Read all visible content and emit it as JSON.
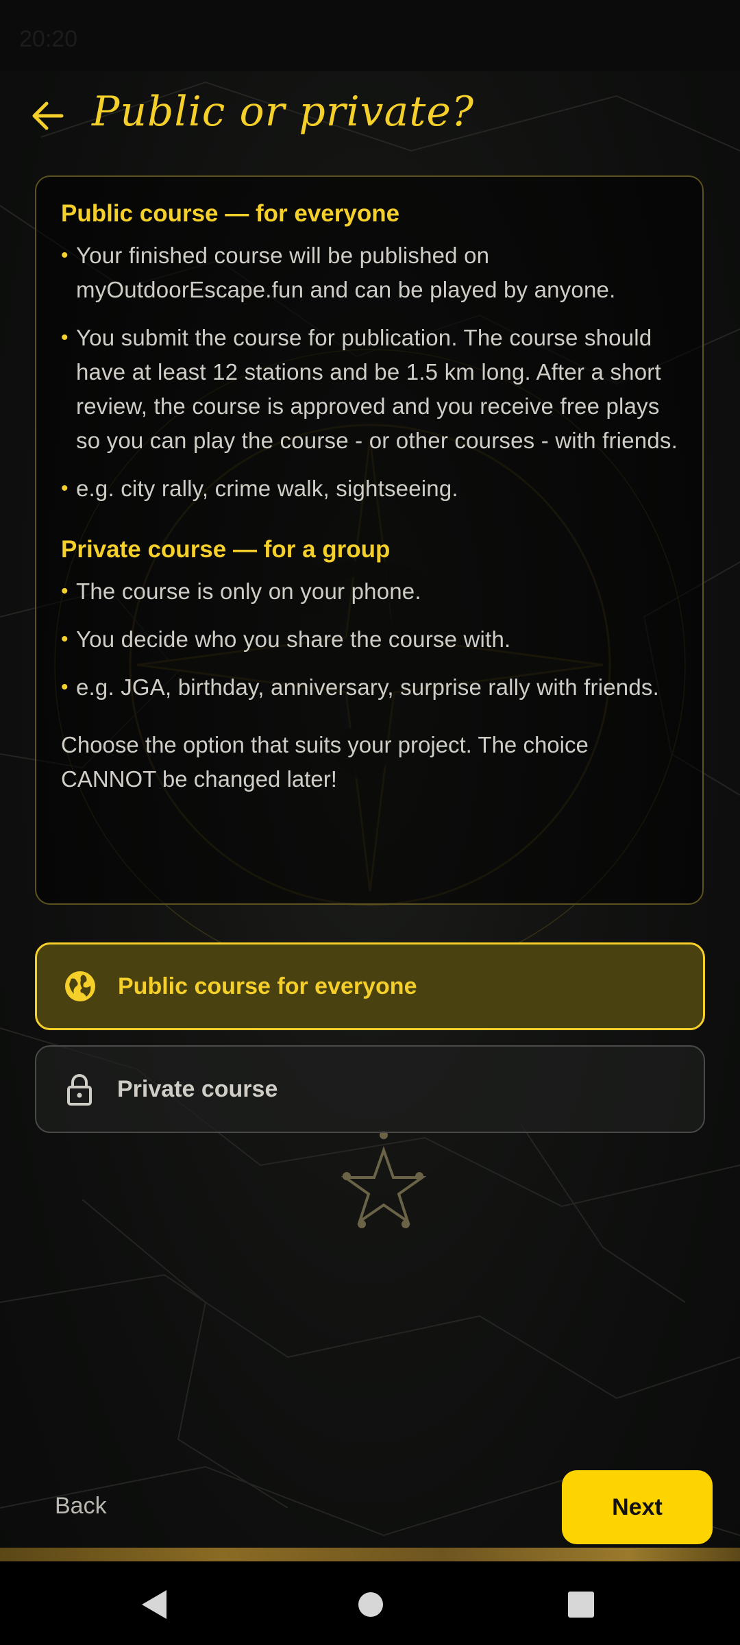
{
  "status_bar": {
    "time": "20:20"
  },
  "header": {
    "title": "Public or private?"
  },
  "info_card": {
    "public_section": {
      "heading": "Public course — for everyone",
      "bullets": [
        "Your finished course will be published on myOutdoorEscape.fun and can be played by anyone.",
        "You submit the course for publication. The course should have at least 12 stations and be 1.5 km long. After a short review, the course is approved and you receive free plays so you can play the course - or other courses - with friends.",
        "e.g. city rally, crime walk, sightseeing."
      ]
    },
    "private_section": {
      "heading": "Private course — for a group",
      "bullets": [
        "The course is only on your phone.",
        "You decide who you share the course with.",
        "e.g. JGA, birthday, anniversary, surprise rally with friends."
      ]
    },
    "footer": "Choose the option that suits your project. The choice CANNOT be changed later!"
  },
  "options": {
    "public": {
      "label": "Public course for everyone",
      "icon": "globe-icon",
      "selected": true
    },
    "private": {
      "label": "Private course",
      "icon": "lock-icon",
      "selected": false
    }
  },
  "footer_nav": {
    "back_label": "Back",
    "next_label": "Next"
  },
  "colors": {
    "accent": "#f5cf2a",
    "next_button": "#fdd400",
    "background": "#0c0d0c"
  }
}
